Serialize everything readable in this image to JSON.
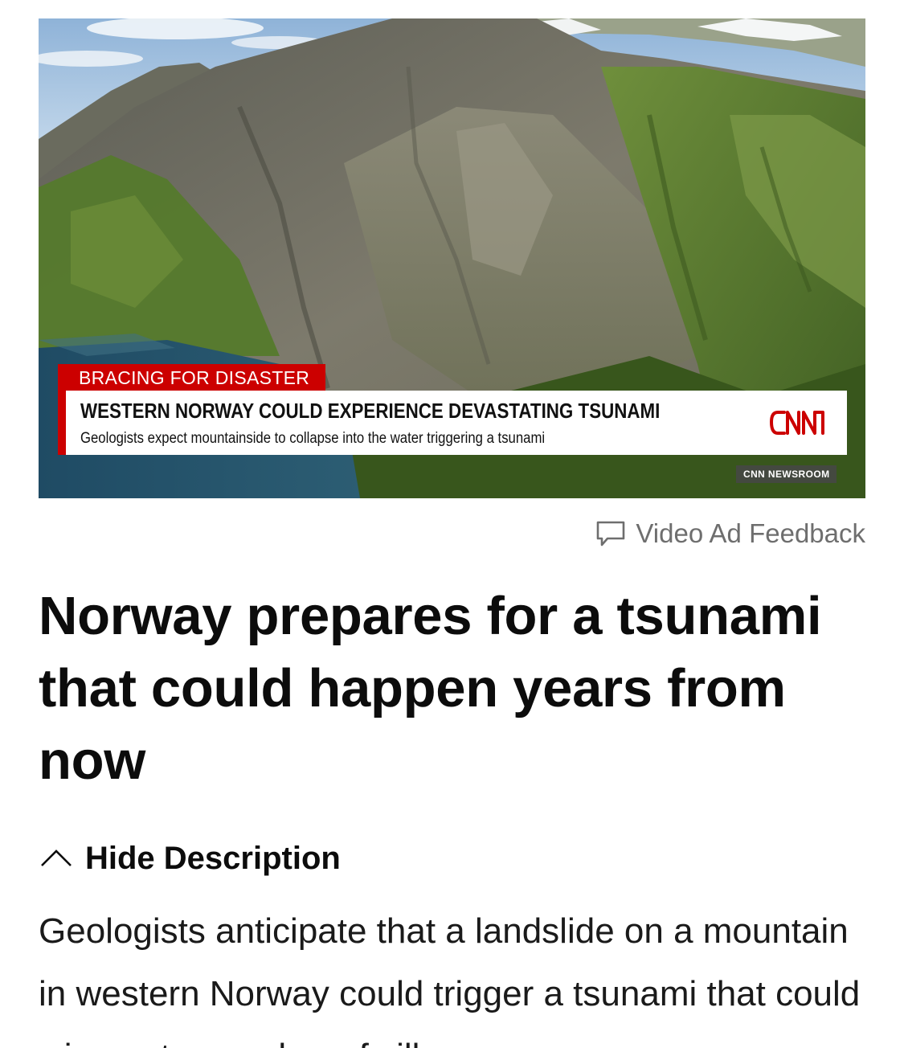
{
  "video": {
    "chyron_label": "BRACING FOR DISASTER",
    "chyron_headline": "WESTERN NORWAY COULD EXPERIENCE DEVASTATING TSUNAMI",
    "chyron_subheadline": "Geologists expect mountainside to collapse into the water triggering a tsunami",
    "network_logo": "CNN",
    "program_tag": "CNN NEWSROOM",
    "accent_color": "#cc0000"
  },
  "ad_feedback": {
    "icon": "feedback-icon",
    "label": "Video Ad Feedback"
  },
  "article": {
    "headline": "Norway prepares for a tsunami that could happen years from now",
    "description_toggle": {
      "icon": "chevron-up-icon",
      "label": "Hide Description"
    },
    "description": "Geologists anticipate that a landslide on a mountain in western Norway could trigger a tsunami that could wipe out a number of villages"
  }
}
